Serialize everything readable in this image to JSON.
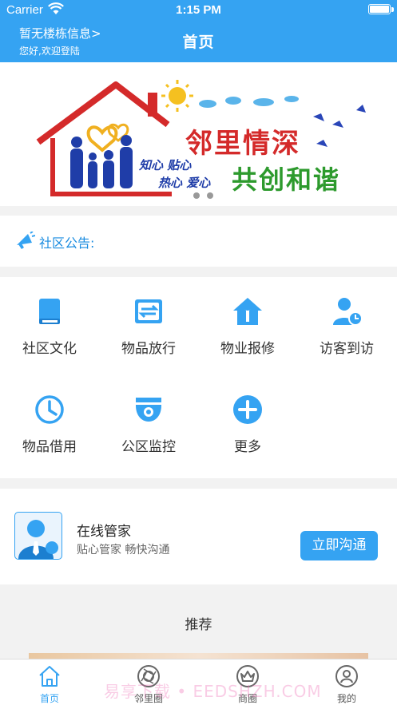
{
  "status_bar": {
    "carrier": "Carrier",
    "time": "1:15 PM"
  },
  "header": {
    "building_link": "暂无楼栋信息>",
    "welcome": "您好,欢迎登陆",
    "title": "首页"
  },
  "banner": {
    "headline": "邻里情深",
    "slogan": "共创和谐",
    "tag1": "知心 贴心",
    "tag2": "热心 爱心",
    "slide_count": 2
  },
  "notice": {
    "label": "社区公告:"
  },
  "services": [
    {
      "label": "社区文化",
      "icon": "book-icon"
    },
    {
      "label": "物品放行",
      "icon": "release-icon"
    },
    {
      "label": "物业报修",
      "icon": "repair-icon"
    },
    {
      "label": "访客到访",
      "icon": "visitor-icon"
    },
    {
      "label": "物品借用",
      "icon": "clock-icon"
    },
    {
      "label": "公区监控",
      "icon": "camera-icon"
    },
    {
      "label": "更多",
      "icon": "plus-icon"
    }
  ],
  "butler": {
    "title": "在线管家",
    "subtitle": "贴心管家 畅快沟通",
    "button": "立即沟通"
  },
  "recommend": {
    "title": "推荐"
  },
  "tabbar": {
    "items": [
      {
        "label": "首页",
        "icon": "home-icon",
        "active": true
      },
      {
        "label": "邻里圈",
        "icon": "camera-lens-icon",
        "active": false
      },
      {
        "label": "商圈",
        "icon": "shop-icon",
        "active": false
      },
      {
        "label": "我的",
        "icon": "profile-icon",
        "active": false
      }
    ]
  },
  "watermark": "易享下载 • EEDSHZH.COM",
  "colors": {
    "primary": "#35a3f2",
    "background": "#f2f2f2"
  }
}
